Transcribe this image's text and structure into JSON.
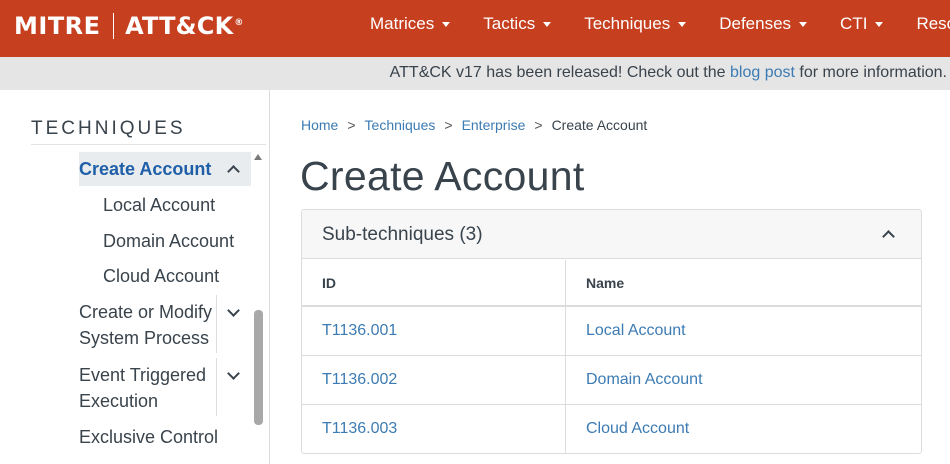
{
  "brand": {
    "mitre": "MITRE",
    "attck": "ATT&CK",
    "registered": "®"
  },
  "nav": {
    "items": [
      {
        "label": "Matrices"
      },
      {
        "label": "Tactics"
      },
      {
        "label": "Techniques"
      },
      {
        "label": "Defenses"
      },
      {
        "label": "CTI"
      },
      {
        "label": "Resour"
      }
    ]
  },
  "banner": {
    "text_before": "ATT&CK v17 has been released! Check out the ",
    "link": "blog post",
    "text_after": " for more information."
  },
  "sidebar": {
    "heading": "TECHNIQUES",
    "active_item": "Create Account",
    "sub_items": [
      "Local Account",
      "Domain Account",
      "Cloud Account"
    ],
    "items": [
      {
        "line1": "Create or Modify",
        "line2": "System Process"
      },
      {
        "line1": "Event Triggered",
        "line2": "Execution"
      },
      {
        "line1": "Exclusive Control"
      }
    ]
  },
  "breadcrumb": {
    "home": "Home",
    "techniques": "Techniques",
    "enterprise": "Enterprise",
    "current": "Create Account",
    "separator": ">"
  },
  "page": {
    "title": "Create Account"
  },
  "subtechniques": {
    "heading": "Sub-techniques (3)",
    "columns": [
      "ID",
      "Name"
    ],
    "rows": [
      {
        "id": "T1136.001",
        "name": "Local Account"
      },
      {
        "id": "T1136.002",
        "name": "Domain Account"
      },
      {
        "id": "T1136.003",
        "name": "Cloud Account"
      }
    ]
  },
  "colors": {
    "brand": "#c63f1f",
    "link": "#3c7bb3",
    "active": "#1f5fa8",
    "text": "#39434c"
  }
}
